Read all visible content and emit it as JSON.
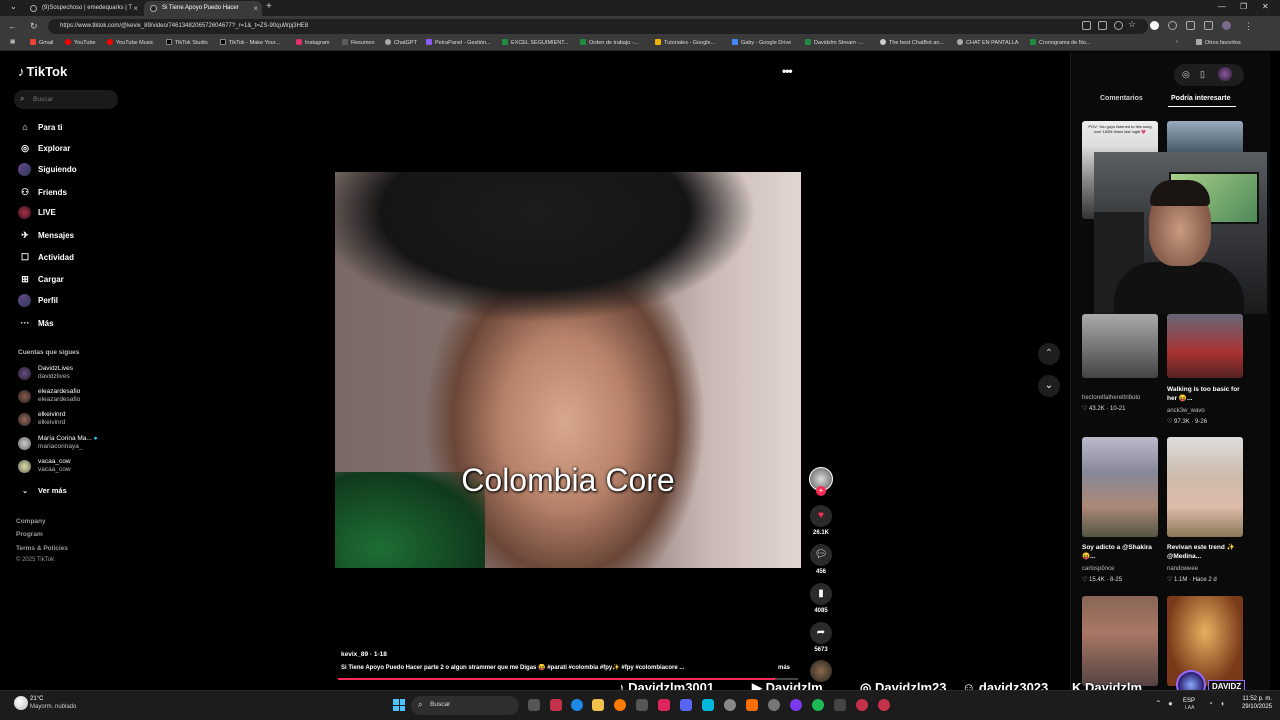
{
  "browser": {
    "tabs": [
      {
        "title": "(9)Sospechoso | emedequarks | T"
      },
      {
        "title": "Si Tiene Apoyo Puedo Hacer"
      }
    ],
    "url": "https://www.tiktok.com/@kevix_89/video/7461348206572604677?_r=1&_t=ZS-90quWpj3HE8",
    "bookmarks": [
      "Gmail",
      "YouTube",
      "YouTube Music",
      "TikTok Studio",
      "TikTok - Make Your...",
      "Instagram",
      "Resumen",
      "ChatGPT",
      "PetraPanel - Gestión...",
      "EXCEL SEGUIMIENT...",
      "Orden de trabajo -...",
      "Tutoriales - Google...",
      "Gaby - Google Drive",
      "Davidzlm Stream -...",
      "The best ChatBot an...",
      "CHAT EN PANTALLA",
      "Cronograma de No..."
    ],
    "bookmarks_other": "Otros favoritos"
  },
  "sidebar": {
    "logo": "TikTok",
    "search_placeholder": "Buscar",
    "nav": [
      {
        "label": "Para ti",
        "icon": "home-icon"
      },
      {
        "label": "Explorar",
        "icon": "compass-icon"
      },
      {
        "label": "Siguiendo",
        "icon": "following-icon"
      },
      {
        "label": "Friends",
        "icon": "friends-icon"
      },
      {
        "label": "LIVE",
        "icon": "live-icon"
      },
      {
        "label": "Mensajes",
        "icon": "messages-icon"
      },
      {
        "label": "Actividad",
        "icon": "activity-icon"
      },
      {
        "label": "Cargar",
        "icon": "upload-icon"
      },
      {
        "label": "Perfil",
        "icon": "profile-icon"
      },
      {
        "label": "Más",
        "icon": "more-icon"
      }
    ],
    "following_title": "Cuentas que sigues",
    "following": [
      {
        "name": "DavidzLives",
        "handle": "davidzlives"
      },
      {
        "name": "eleazardesafio",
        "handle": "eleazardesafio"
      },
      {
        "name": "elkeivinrd",
        "handle": "elkeivinrd"
      },
      {
        "name": "María Corina Ma...",
        "handle": "mariacorinaya_"
      },
      {
        "name": "vacaa_cow",
        "handle": "vacaa_cow"
      }
    ],
    "see_more": "Ver más",
    "footer": [
      "Company",
      "Program",
      "Terms & Policies",
      "© 2025 TikTok"
    ]
  },
  "video": {
    "caption_overlay": "Colombia Core",
    "author": "kevix_89 · 1-18",
    "description": "Si Tiene Apoyo Puedo Hacer parte 2 o algun strammer que me Digas 😝 #parati #colombia #fpy✨ #fpy #colombiacore ...",
    "more_label": "más",
    "progress": 0.95,
    "likes": "26.1K",
    "comments": "456",
    "saves": "4085",
    "shares": "5673"
  },
  "right_panel": {
    "tabs": [
      "Comentarios",
      "Podría interesarte"
    ],
    "cards": [
      {
        "caption": "POV: You guys listened to this song over 160M times last night 💗",
        "user": "",
        "stat": ""
      },
      {
        "caption": "",
        "user": "",
        "stat": ""
      },
      {
        "caption": "",
        "user": "hectorelfatherettributo",
        "stat": "43.2K · 10-21"
      },
      {
        "caption": "Walking is too basic for her 😝...",
        "user": "anck3w_wavo",
        "stat": "97.3K · 9-26"
      },
      {
        "caption": "Soy adicto a @Shakira 😝...",
        "user": "carlospönce",
        "stat": "15.4K · 8-25"
      },
      {
        "caption": "Revivan este trend ✨ @Medina...",
        "user": "nandoweee",
        "stat": "1.1M · Hace 2 d"
      }
    ]
  },
  "overlay": {
    "socials": [
      {
        "icon": "tiktok-icon",
        "label": "Davidzlm3001"
      },
      {
        "icon": "youtube-icon",
        "label": "Davidzlm"
      },
      {
        "icon": "instagram-icon",
        "label": "Davidzlm23"
      },
      {
        "icon": "discord-icon",
        "label": "davidz3023"
      },
      {
        "icon": "kick-icon",
        "label": "Davidzlm"
      }
    ],
    "brand": "DAVIDZ"
  },
  "taskbar": {
    "weather_temp": "21°C",
    "weather_desc": "Mayorm. nublado",
    "search": "Buscar",
    "lang": "ESP",
    "lang2": "LAA",
    "time": "11:52 p. m.",
    "date": "29/10/2025"
  },
  "colors": {
    "accent": "#fe2c55",
    "start": "#4cc2ff"
  }
}
